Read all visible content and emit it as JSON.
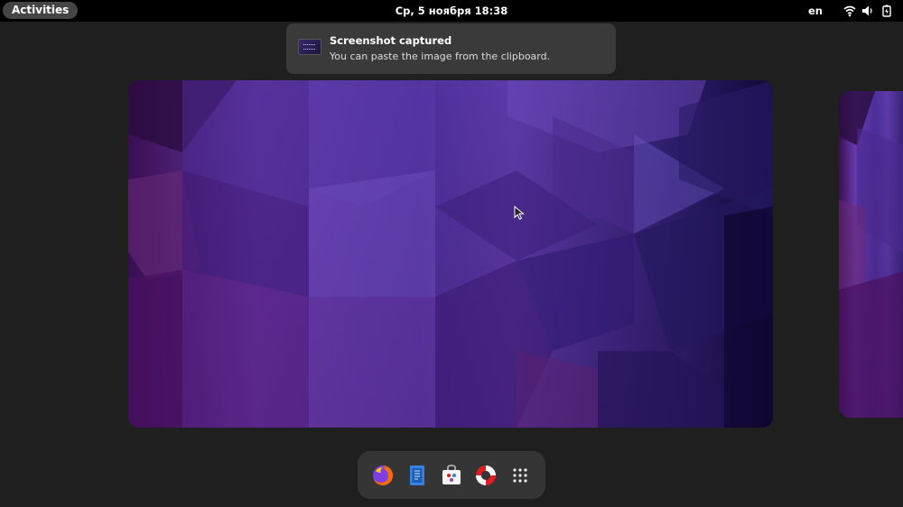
{
  "topbar": {
    "activities_label": "Activities",
    "clock": "Ср, 5 ноября  18:38",
    "keyboard_layout": "en",
    "tray_icons": [
      "wifi-icon",
      "volume-icon",
      "battery-icon"
    ]
  },
  "notification": {
    "title": "Screenshot captured",
    "body": "You can paste the image from the clipboard.",
    "icon": "screenshot-thumbnail-icon"
  },
  "dash": {
    "items": [
      {
        "name": "firefox-icon"
      },
      {
        "name": "text-editor-icon"
      },
      {
        "name": "software-icon"
      },
      {
        "name": "help-icon"
      },
      {
        "name": "show-apps-icon"
      }
    ]
  },
  "colors": {
    "panel": "#000000",
    "background": "#1f1f1f",
    "notification_bg": "#3a3a3a",
    "dash_bg": "#353535",
    "wallpaper_accent": "#6a3db0"
  }
}
